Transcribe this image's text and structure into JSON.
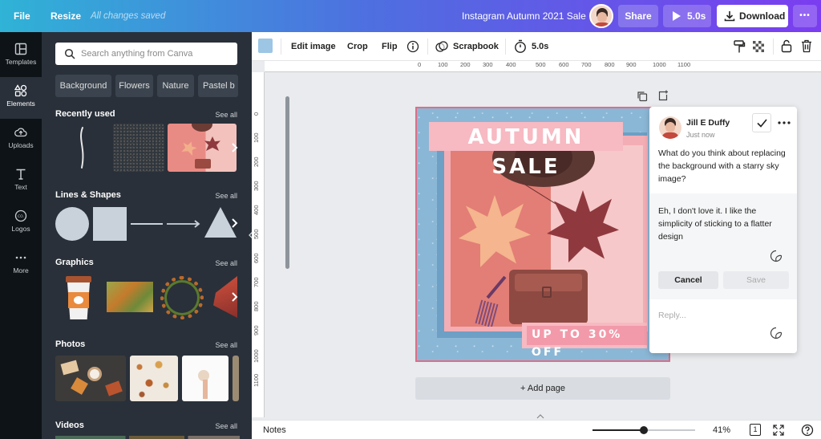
{
  "topbar": {
    "file": "File",
    "resize": "Resize",
    "saved_status": "All changes saved",
    "doc_title": "Instagram Autumn 2021 Sale",
    "share": "Share",
    "play_duration": "5.0s",
    "download": "Download",
    "more": "•••"
  },
  "rail": [
    {
      "label": "Templates"
    },
    {
      "label": "Elements"
    },
    {
      "label": "Uploads"
    },
    {
      "label": "Text"
    },
    {
      "label": "Logos"
    },
    {
      "label": "More"
    }
  ],
  "panel": {
    "search_placeholder": "Search anything from Canva",
    "chips": [
      "Background",
      "Flowers",
      "Nature",
      "Pastel b"
    ],
    "sections": [
      {
        "title": "Recently used",
        "see_all": "See all"
      },
      {
        "title": "Lines & Shapes",
        "see_all": "See all"
      },
      {
        "title": "Graphics",
        "see_all": "See all"
      },
      {
        "title": "Photos",
        "see_all": "See all"
      },
      {
        "title": "Videos",
        "see_all": "See all"
      }
    ]
  },
  "toolbar": {
    "edit_image": "Edit image",
    "crop": "Crop",
    "flip": "Flip",
    "scrapbook": "Scrapbook",
    "duration": "5.0s",
    "color": "#9cc6e4"
  },
  "ruler": {
    "top": [
      "0",
      "100",
      "200",
      "300",
      "400",
      "500",
      "600",
      "700",
      "800",
      "900",
      "1000",
      "1100"
    ],
    "left": [
      "0",
      "100",
      "200",
      "300",
      "400",
      "500",
      "600",
      "700",
      "800",
      "900",
      "1000",
      "1100"
    ]
  },
  "design": {
    "headline": "AUTUMN SALE",
    "subline": "UP TO 30% OFF"
  },
  "comment": {
    "author": "Jill E Duffy",
    "time": "Just now",
    "question": "What do you think about replacing the background with a starry sky image?",
    "draft": "Eh, I don't love it. I like the simplicity of sticking to a flatter design",
    "cancel": "Cancel",
    "save": "Save",
    "reply_placeholder": "Reply..."
  },
  "add_page": "+ Add page",
  "bottombar": {
    "notes": "Notes",
    "zoom": "41%",
    "page_count": "1",
    "zoom_fraction": 0.5
  }
}
